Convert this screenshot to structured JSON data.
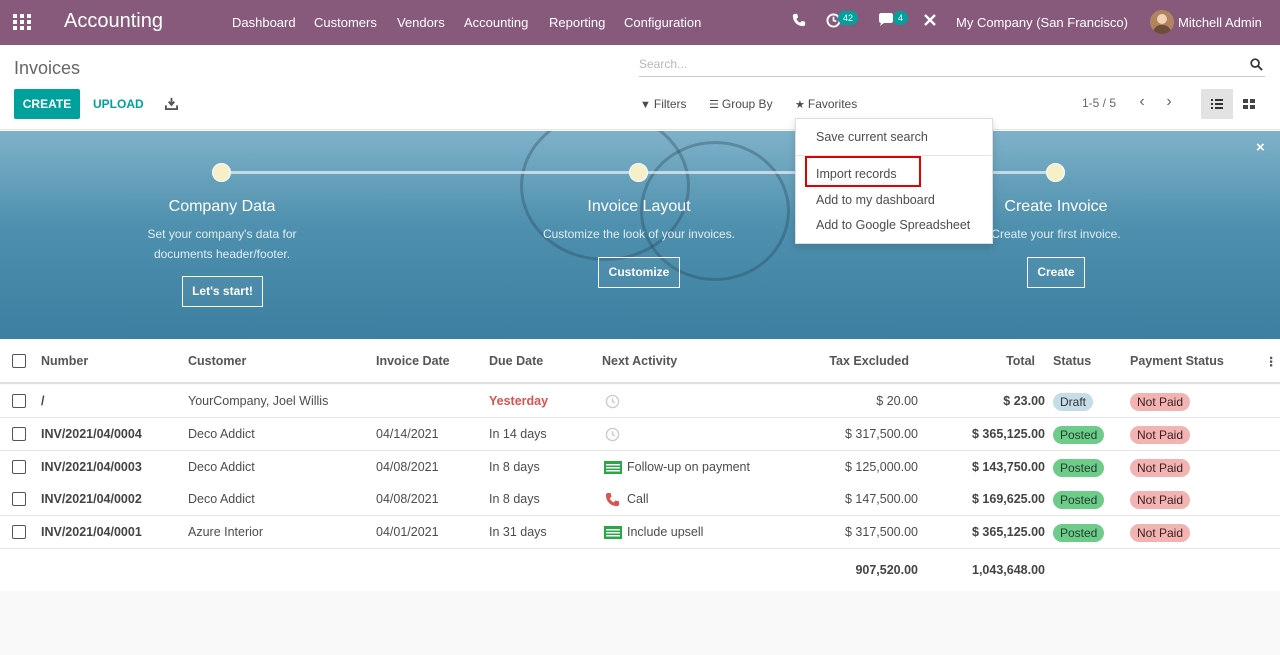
{
  "navbar": {
    "app_name": "Accounting",
    "menu": [
      "Dashboard",
      "Customers",
      "Vendors",
      "Accounting",
      "Reporting",
      "Configuration"
    ],
    "activity_count": "42",
    "messages_count": "4",
    "company": "My Company (San Francisco)",
    "user": "Mitchell Admin"
  },
  "control_panel": {
    "breadcrumb": "Invoices",
    "search_placeholder": "Search...",
    "create_label": "CREATE",
    "upload_label": "UPLOAD",
    "filters_label": "Filters",
    "groupby_label": "Group By",
    "favorites_label": "Favorites",
    "pager": "1-5 / 5"
  },
  "favorites_menu": {
    "items": [
      "Save current search",
      "Import records",
      "Add to my dashboard",
      "Add to Google Spreadsheet"
    ]
  },
  "banner": {
    "steps": [
      {
        "title": "Company Data",
        "desc1": "Set your company's data for",
        "desc2": "documents header/footer.",
        "button": "Let's start!"
      },
      {
        "title": "Invoice Layout",
        "desc1": "Customize the look of your invoices.",
        "desc2": "",
        "button": "Customize"
      },
      {
        "title": "Create Invoice",
        "desc1": "Create your first invoice.",
        "desc2": "",
        "button": "Create"
      }
    ],
    "close_label": "×"
  },
  "table": {
    "columns": [
      "Number",
      "Customer",
      "Invoice Date",
      "Due Date",
      "Next Activity",
      "Tax Excluded",
      "Total",
      "Status",
      "Payment Status"
    ],
    "rows": [
      {
        "number": "/",
        "customer": "YourCompany, Joel Willis",
        "invoice_date": "",
        "due_date": "Yesterday",
        "due_overdue": true,
        "activity_icon": "clock-icon",
        "activity": "",
        "tax_excluded": "$ 20.00",
        "total": "$ 23.00",
        "status": "Draft",
        "payment": "Not Paid"
      },
      {
        "number": "INV/2021/04/0004",
        "customer": "Deco Addict",
        "invoice_date": "04/14/2021",
        "due_date": "In 14 days",
        "due_overdue": false,
        "activity_icon": "clock-icon",
        "activity": "",
        "tax_excluded": "$ 317,500.00",
        "total": "$ 365,125.00",
        "status": "Posted",
        "payment": "Not Paid"
      },
      {
        "number": "INV/2021/04/0003",
        "customer": "Deco Addict",
        "invoice_date": "04/08/2021",
        "due_date": "In 8 days",
        "due_overdue": false,
        "activity_icon": "money-icon",
        "activity": "Follow-up on payment",
        "tax_excluded": "$ 125,000.00",
        "total": "$ 143,750.00",
        "status": "Posted",
        "payment": "Not Paid"
      },
      {
        "number": "INV/2021/04/0002",
        "customer": "Deco Addict",
        "invoice_date": "04/08/2021",
        "due_date": "In 8 days",
        "due_overdue": false,
        "activity_icon": "phone-icon",
        "activity": "Call",
        "tax_excluded": "$ 147,500.00",
        "total": "$ 169,625.00",
        "status": "Posted",
        "payment": "Not Paid"
      },
      {
        "number": "INV/2021/04/0001",
        "customer": "Azure Interior",
        "invoice_date": "04/01/2021",
        "due_date": "In 31 days",
        "due_overdue": false,
        "activity_icon": "money-icon",
        "activity": "Include upsell",
        "tax_excluded": "$ 317,500.00",
        "total": "$ 365,125.00",
        "status": "Posted",
        "payment": "Not Paid"
      }
    ],
    "totals": {
      "tax_excluded": "907,520.00",
      "total": "1,043,648.00"
    }
  },
  "colors": {
    "brand": "#875a7b",
    "primary": "#00a09d",
    "overdue": "#d9534f"
  }
}
